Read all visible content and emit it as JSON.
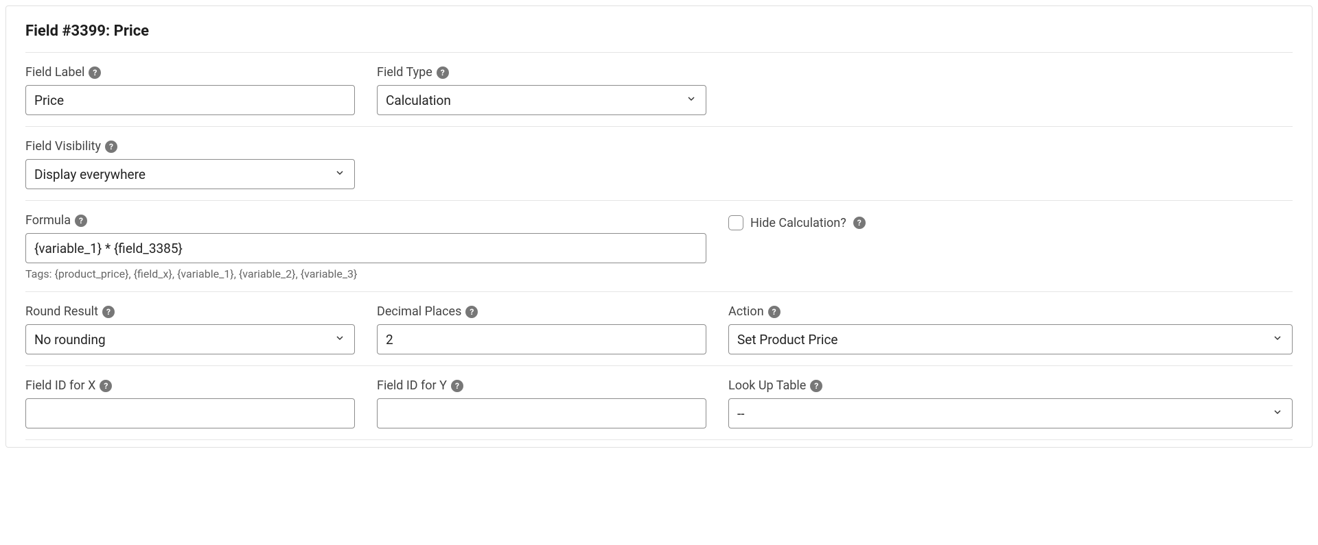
{
  "panel": {
    "title": "Field #3399: Price"
  },
  "fields": {
    "field_label": {
      "label": "Field Label",
      "value": "Price"
    },
    "field_type": {
      "label": "Field Type",
      "value": "Calculation"
    },
    "field_visibility": {
      "label": "Field Visibility",
      "value": "Display everywhere"
    },
    "formula": {
      "label": "Formula",
      "value": "{variable_1} * {field_3385}",
      "hint": "Tags: {product_price}, {field_x}, {variable_1}, {variable_2}, {variable_3}"
    },
    "hide_calc": {
      "label": "Hide Calculation?",
      "checked": false
    },
    "round_result": {
      "label": "Round Result",
      "value": "No rounding"
    },
    "decimal_places": {
      "label": "Decimal Places",
      "value": "2"
    },
    "action": {
      "label": "Action",
      "value": "Set Product Price"
    },
    "field_id_x": {
      "label": "Field ID for X",
      "value": ""
    },
    "field_id_y": {
      "label": "Field ID for Y",
      "value": ""
    },
    "lookup_table": {
      "label": "Look Up Table",
      "value": "--"
    }
  }
}
